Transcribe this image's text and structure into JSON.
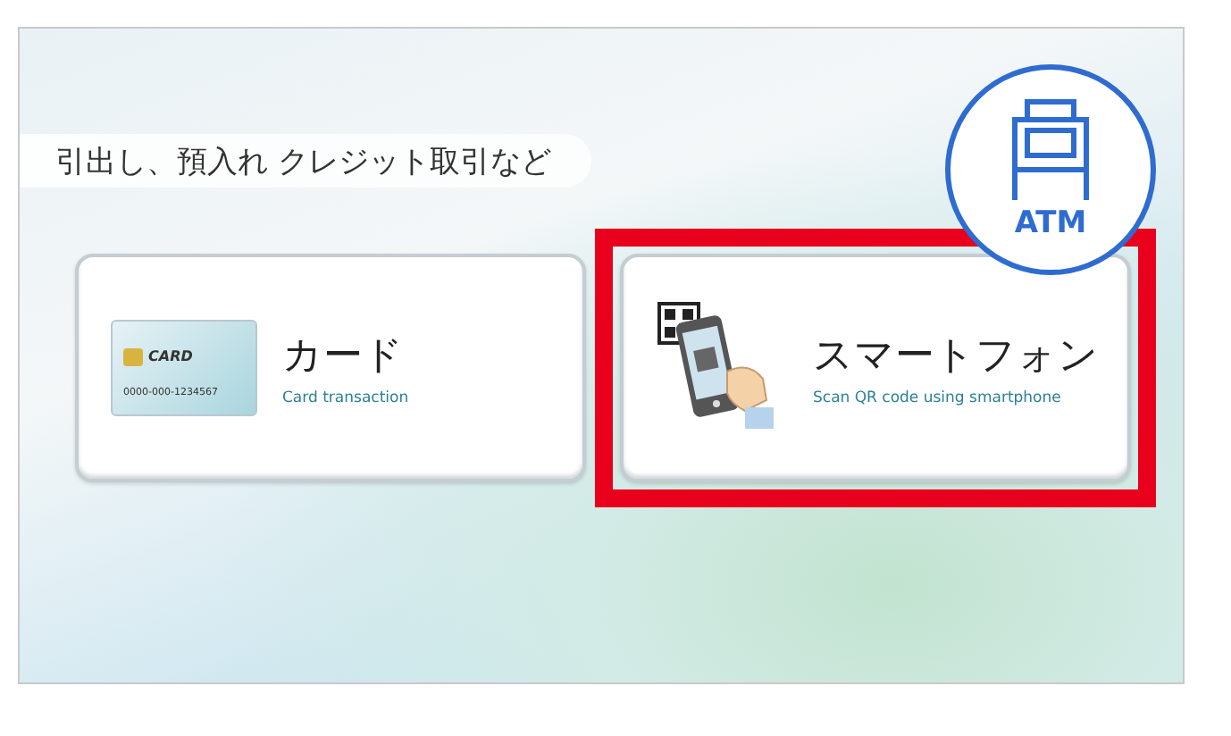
{
  "banner": {
    "text": "引出し、預入れ クレジット取引など"
  },
  "atm_badge": {
    "label": "ATM"
  },
  "options": [
    {
      "kind": "card",
      "title": "カード",
      "subtitle": "Card transaction",
      "selected": false,
      "card_label": "CARD",
      "card_number": "0000-000-1234567"
    },
    {
      "kind": "smartphone",
      "title": "スマートフォン",
      "subtitle": "Scan QR code using smartphone",
      "selected": true
    }
  ]
}
